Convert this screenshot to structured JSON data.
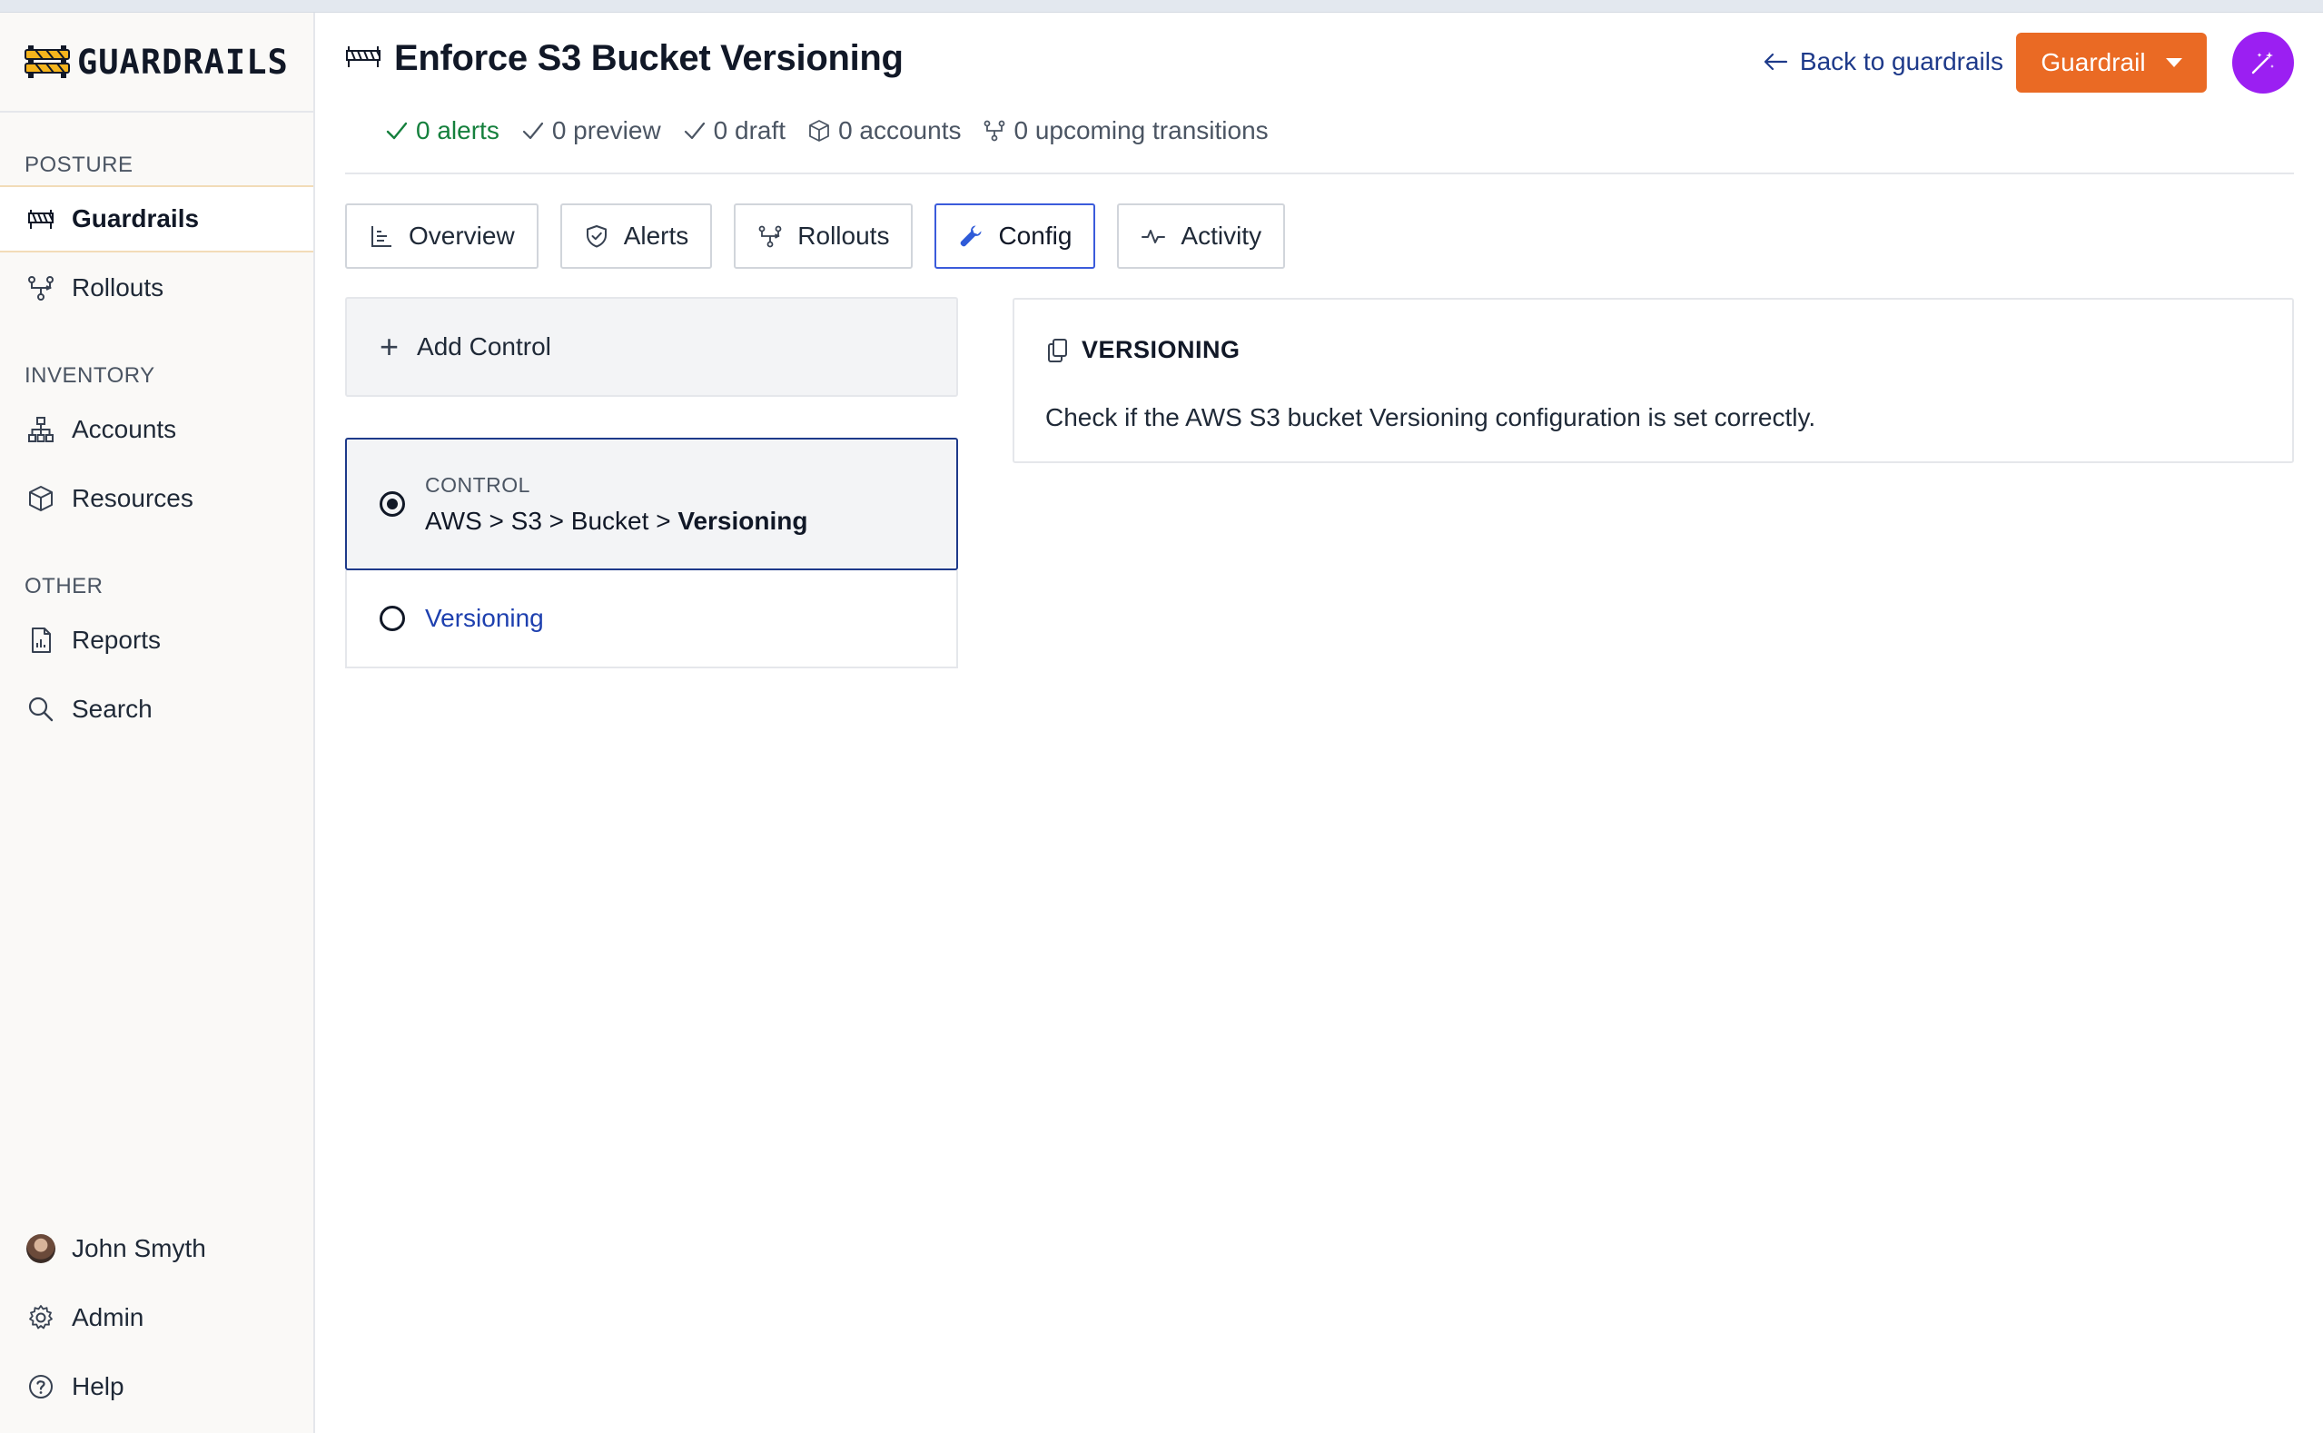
{
  "brand": {
    "name": "GUARDRAILS"
  },
  "sidebar": {
    "sections": [
      {
        "label": "POSTURE"
      },
      {
        "label": "INVENTORY"
      },
      {
        "label": "OTHER"
      }
    ],
    "items": [
      {
        "label": "Guardrails",
        "icon": "barrier-icon",
        "active": true
      },
      {
        "label": "Rollouts",
        "icon": "rollouts-icon"
      },
      {
        "label": "Accounts",
        "icon": "accounts-icon"
      },
      {
        "label": "Resources",
        "icon": "cube-icon"
      },
      {
        "label": "Reports",
        "icon": "report-icon"
      },
      {
        "label": "Search",
        "icon": "search-icon"
      }
    ],
    "footer": [
      {
        "label": "John Smyth",
        "icon": "avatar"
      },
      {
        "label": "Admin",
        "icon": "gear-icon"
      },
      {
        "label": "Help",
        "icon": "help-icon"
      }
    ]
  },
  "header": {
    "title": "Enforce S3 Bucket Versioning",
    "back_label": "Back to guardrails",
    "guardrail_button": "Guardrail",
    "stats": {
      "alerts": "0 alerts",
      "preview": "0 preview",
      "draft": "0 draft",
      "accounts": "0 accounts",
      "transitions": "0 upcoming transitions"
    }
  },
  "tabs": [
    {
      "label": "Overview",
      "icon": "chart-icon"
    },
    {
      "label": "Alerts",
      "icon": "shield-icon"
    },
    {
      "label": "Rollouts",
      "icon": "rollouts-icon"
    },
    {
      "label": "Config",
      "icon": "wrench-icon",
      "active": true
    },
    {
      "label": "Activity",
      "icon": "pulse-icon"
    }
  ],
  "config": {
    "add_control_label": "Add Control",
    "control": {
      "type_label": "CONTROL",
      "path_prefix": "AWS > S3 > Bucket > ",
      "path_last": "Versioning",
      "child": "Versioning"
    },
    "detail": {
      "title": "VERSIONING",
      "description": "Check if the AWS S3 bucket Versioning configuration is set correctly."
    }
  },
  "colors": {
    "accent_orange": "#ea6a24",
    "accent_purple": "#9b1ff2",
    "link_blue": "#1e3a8a",
    "success_green": "#15803d"
  }
}
